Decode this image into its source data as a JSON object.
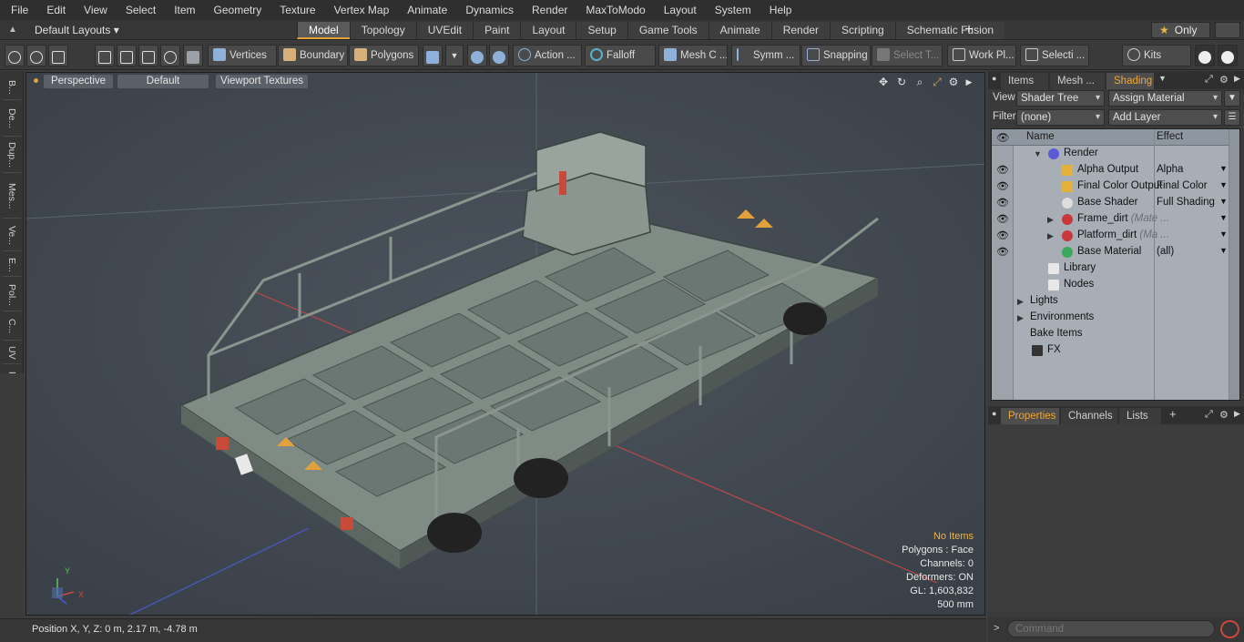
{
  "menu": [
    "File",
    "Edit",
    "View",
    "Select",
    "Item",
    "Geometry",
    "Texture",
    "Vertex Map",
    "Animate",
    "Dynamics",
    "Render",
    "MaxToModo",
    "Layout",
    "System",
    "Help"
  ],
  "layout": {
    "preset": "Default Layouts ▾",
    "tabs": [
      "Model",
      "Topology",
      "UVEdit",
      "Paint",
      "Layout",
      "Setup",
      "Game Tools",
      "Animate",
      "Render",
      "Scripting",
      "Schematic Fusion"
    ],
    "active_tab": "Model",
    "add_tab": "+",
    "only_label": "Only",
    "star": "★"
  },
  "toolbar": {
    "vertices": "Vertices",
    "boundary": "Boundary",
    "polygons": "Polygons",
    "action": "Action ...",
    "falloff": "Falloff",
    "mesh": "Mesh C ...",
    "symm": "Symm ...",
    "snapping": "Snapping",
    "select_t": "Select T...",
    "work_pl": "Work Pl...",
    "selecti": "Selecti ...",
    "kits": "Kits"
  },
  "left_tools": [
    "B...",
    "De...",
    "Dup...",
    "Mes...",
    "Ve...",
    "E...",
    "Pol...",
    "C...",
    "UV",
    "F..."
  ],
  "viewport": {
    "mode": "Perspective",
    "style": "Default",
    "textures": "Viewport Textures",
    "axis_x": "X",
    "axis_y": "Y",
    "hud": {
      "no_items": "No Items",
      "polygons": "Polygons : Face",
      "channels": "Channels: 0",
      "deformers": "Deformers: ON",
      "gl": "GL: 1,603,832",
      "scale": "500 mm"
    }
  },
  "status": {
    "position": "Position X, Y, Z:   0 m, 2.17 m, -4.78 m"
  },
  "right_panel": {
    "top_tabs": [
      "Items",
      "Mesh ...",
      "Shading"
    ],
    "active_top_tab": "Shading",
    "view_label": "View",
    "view_value": "Shader Tree",
    "assign_material": "Assign Material",
    "filter_label": "Filter",
    "filter_value": "(none)",
    "add_layer": "Add Layer",
    "tree": {
      "col_name": "Name",
      "col_effect": "Effect",
      "rows": [
        {
          "name": "Render",
          "effect": "",
          "dim": "",
          "eye": false,
          "expand": "▼",
          "icon": "render-icon",
          "color": "#5a5ad8",
          "indent": 1
        },
        {
          "name": "Alpha Output",
          "effect": "Alpha",
          "dim": "",
          "eye": true,
          "expand": "",
          "icon": "output-icon",
          "color": "#e2b23a",
          "indent": 2
        },
        {
          "name": "Final Color Output",
          "effect": "Final Color",
          "dim": "",
          "eye": true,
          "expand": "",
          "icon": "output-icon",
          "color": "#e2b23a",
          "indent": 2
        },
        {
          "name": "Base Shader",
          "effect": "Full Shading",
          "dim": "",
          "eye": true,
          "expand": "",
          "icon": "shader-icon",
          "color": "#dedede",
          "indent": 2
        },
        {
          "name": "Frame_dirt",
          "effect": "",
          "dim": " (Mate ...",
          "eye": true,
          "expand": "▶",
          "icon": "material-group-icon",
          "color": "#c8383a",
          "indent": 2
        },
        {
          "name": "Platform_dirt",
          "effect": "",
          "dim": " (Ma ...",
          "eye": true,
          "expand": "▶",
          "icon": "material-group-icon",
          "color": "#c8383a",
          "indent": 2
        },
        {
          "name": "Base Material",
          "effect": "(all)",
          "dim": "",
          "eye": true,
          "expand": "",
          "icon": "material-icon",
          "color": "#3aa85a",
          "indent": 2
        },
        {
          "name": "Library",
          "effect": "",
          "dim": "",
          "eye": false,
          "expand": "",
          "icon": "folder-icon",
          "color": "#e8e8e8",
          "indent": 1
        },
        {
          "name": "Nodes",
          "effect": "",
          "dim": "",
          "eye": false,
          "expand": "",
          "icon": "folder-icon",
          "color": "#e8e8e8",
          "indent": 1
        },
        {
          "name": "Lights",
          "effect": "",
          "dim": "",
          "eye": false,
          "expand": "▶",
          "icon": "",
          "color": "",
          "indent": 0
        },
        {
          "name": "Environments",
          "effect": "",
          "dim": "",
          "eye": false,
          "expand": "▶",
          "icon": "",
          "color": "",
          "indent": 0
        },
        {
          "name": "Bake Items",
          "effect": "",
          "dim": "",
          "eye": false,
          "expand": "",
          "icon": "",
          "color": "",
          "indent": 0
        },
        {
          "name": "FX",
          "effect": "",
          "dim": "",
          "eye": false,
          "expand": "",
          "icon": "fx-icon",
          "color": "#333",
          "indent": 0
        }
      ]
    },
    "bottom_tabs": [
      "Properties",
      "Channels",
      "Lists"
    ],
    "active_bottom_tab": "Properties",
    "add_tab": "+",
    "command_prompt": ">",
    "command_placeholder": "Command"
  },
  "colors": {
    "accent": "#e2a13a",
    "viewport_bg": "#434a52",
    "grid_red": "#c84a4a",
    "grid_blue": "#4a5ac8"
  }
}
